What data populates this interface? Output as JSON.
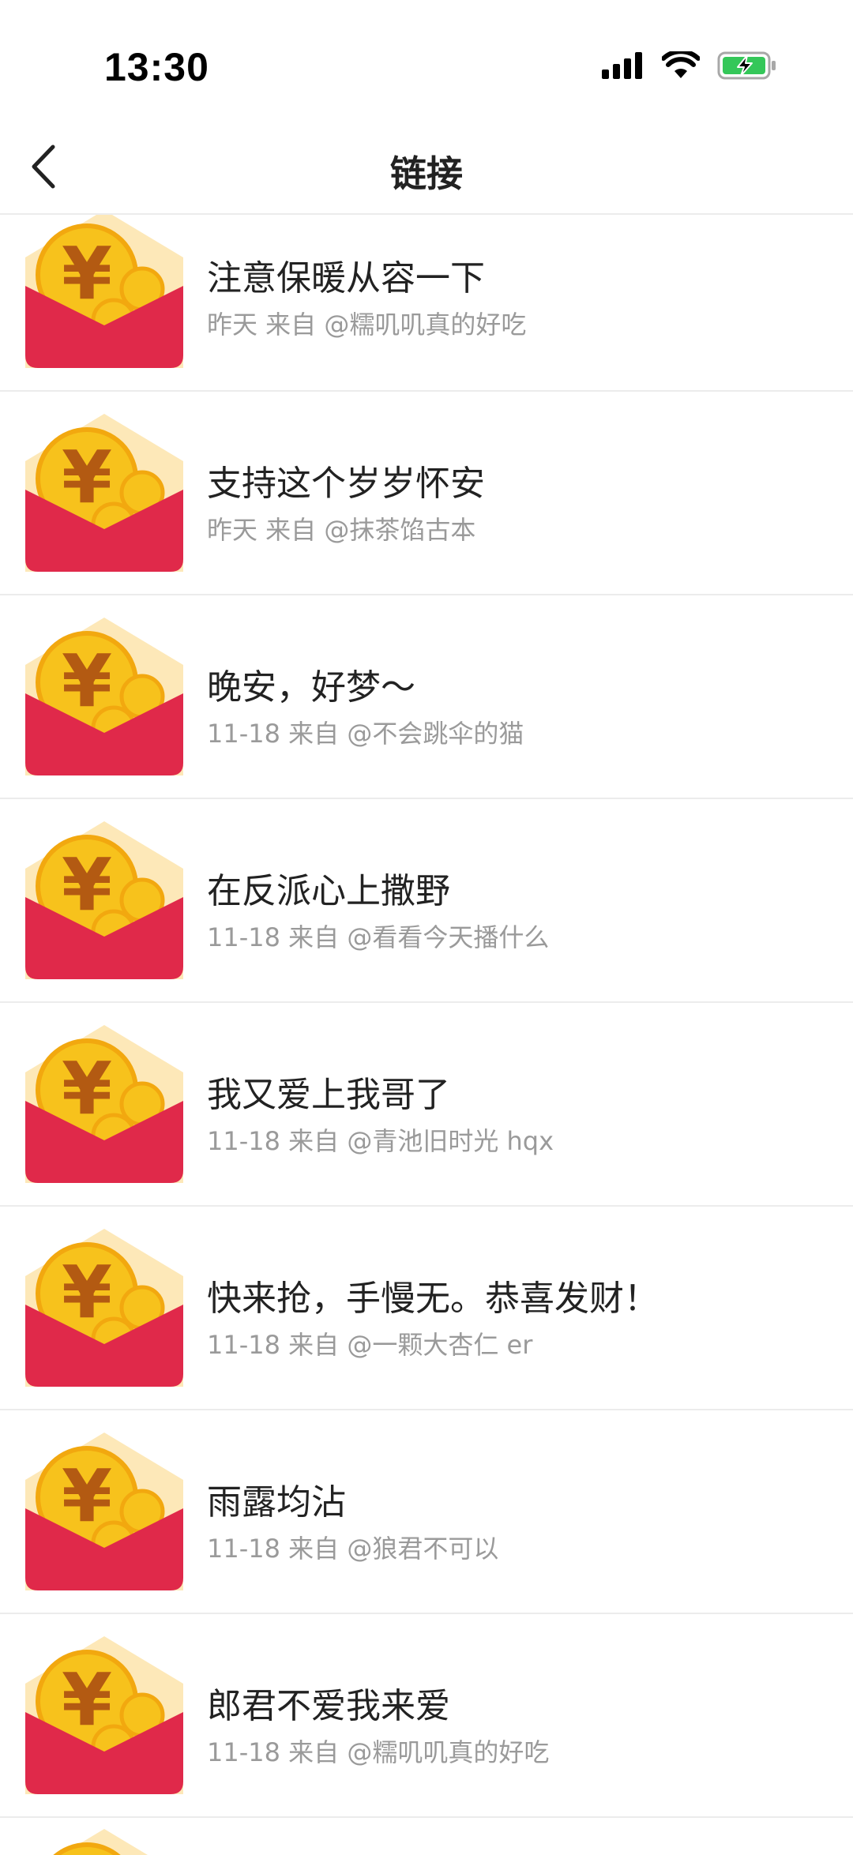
{
  "status_bar": {
    "time": "13:30"
  },
  "nav": {
    "title": "链接",
    "back_icon": "chevron-left-icon"
  },
  "items": [
    {
      "title": "注意保暖从容一下",
      "meta": "昨天 来自 @糯叽叽真的好吃"
    },
    {
      "title": "支持这个岁岁怀安",
      "meta": "昨天 来自 @抹茶馅古本"
    },
    {
      "title": "晚安，好梦～",
      "meta": "11-18 来自 @不会跳伞的猫"
    },
    {
      "title": "在反派心上撒野",
      "meta": "11-18 来自 @看看今天播什么"
    },
    {
      "title": "我又爱上我哥了",
      "meta": "11-18 来自 @青池旧时光 hqx"
    },
    {
      "title": "快来抢，手慢无。恭喜发财！",
      "meta": "11-18 来自 @一颗大杏仁 er"
    },
    {
      "title": "雨露均沾",
      "meta": "11-18 来自 @狼君不可以"
    },
    {
      "title": "郎君不爱我来爱",
      "meta": "11-18 来自 @糯叽叽真的好吃"
    }
  ],
  "colors": {
    "envelope_red": "#e0294a",
    "envelope_flap": "#fde8b8",
    "coin_gold": "#f7c21c",
    "coin_symbol": "#b35a12",
    "battery_green": "#34c759"
  }
}
